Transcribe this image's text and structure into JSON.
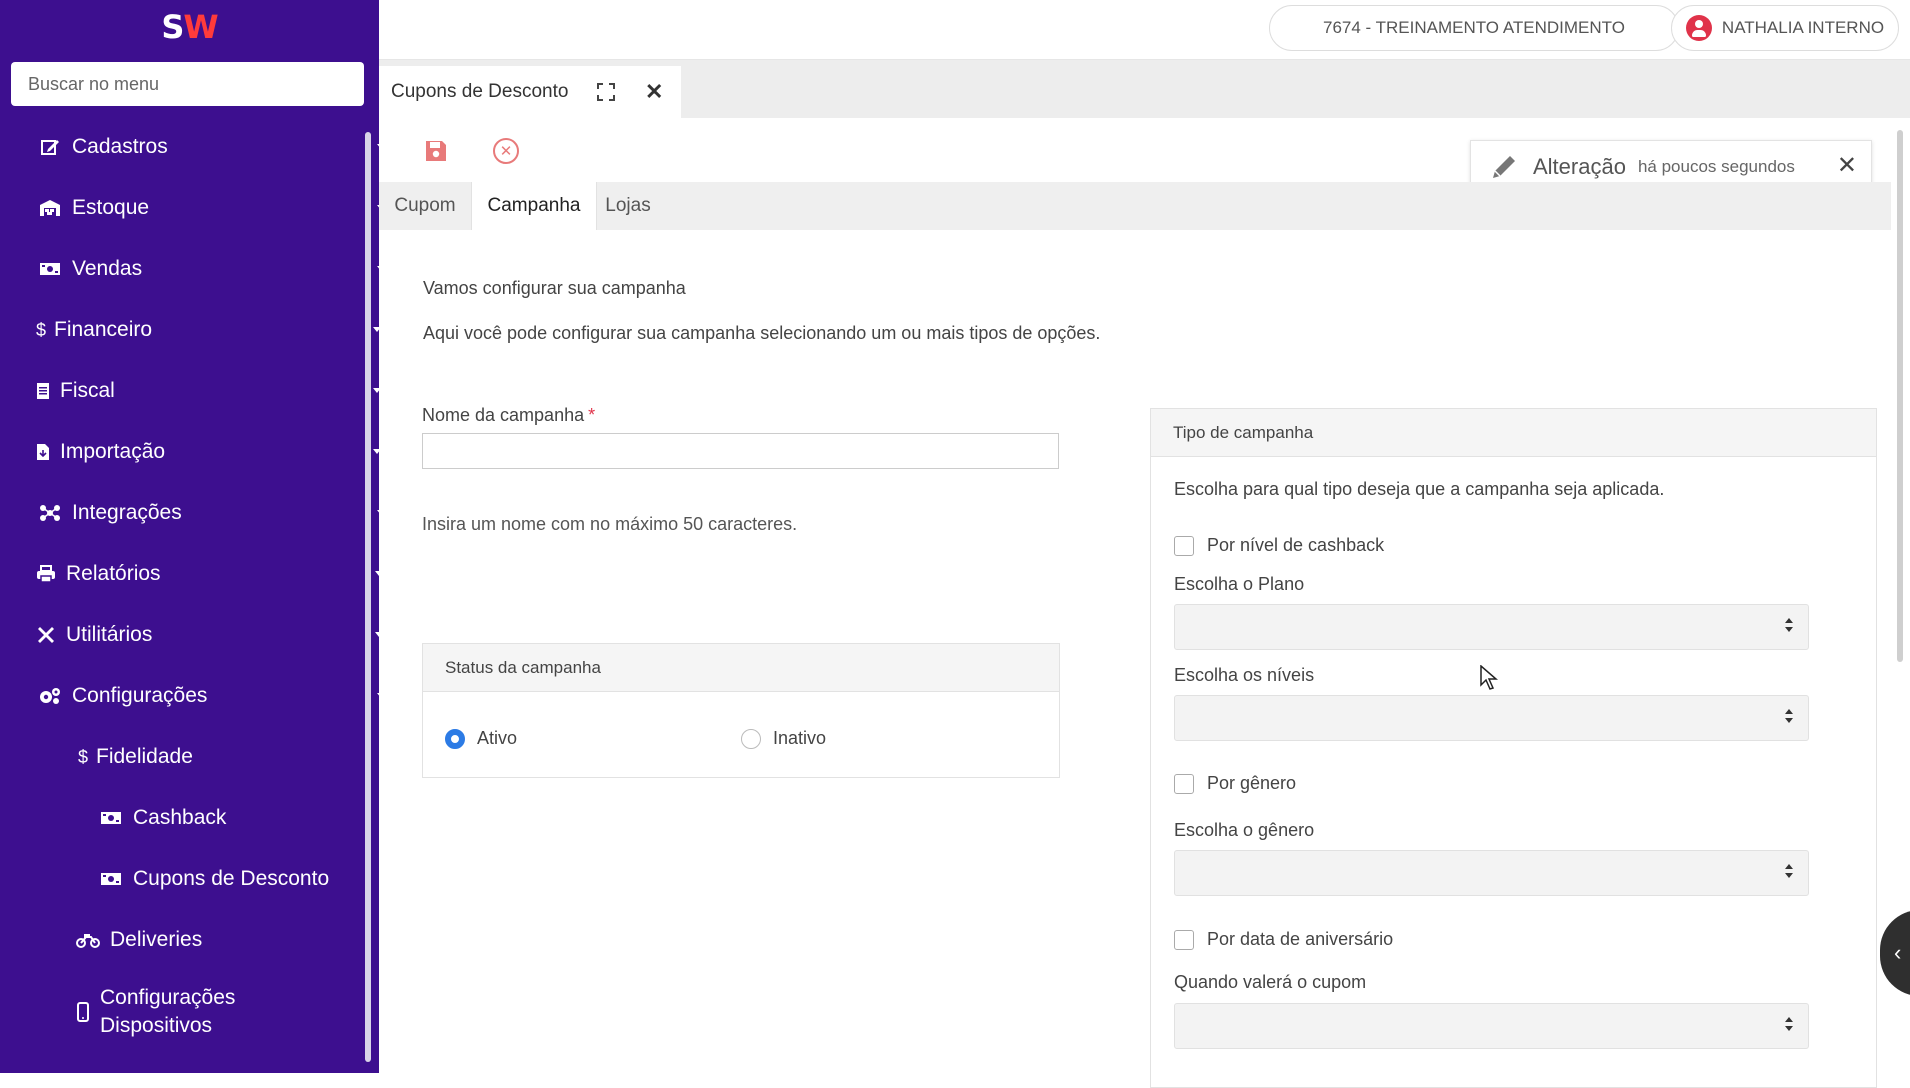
{
  "brand": {
    "logo_s": "S",
    "logo_w": "W"
  },
  "sidebar": {
    "search_placeholder": "Buscar no menu",
    "items": [
      {
        "label": "Cadastros",
        "icon": "edit-icon"
      },
      {
        "label": "Estoque",
        "icon": "warehouse-icon"
      },
      {
        "label": "Vendas",
        "icon": "cash-icon"
      },
      {
        "label": "Financeiro",
        "icon": "dollar-icon"
      },
      {
        "label": "Fiscal",
        "icon": "document-icon"
      },
      {
        "label": "Importação",
        "icon": "file-import-icon"
      },
      {
        "label": "Integrações",
        "icon": "network-icon"
      },
      {
        "label": "Relatórios",
        "icon": "print-icon"
      },
      {
        "label": "Utilitários",
        "icon": "tools-icon"
      },
      {
        "label": "Configurações",
        "icon": "gears-icon"
      },
      {
        "label": "Fidelidade",
        "icon": "dollar-icon"
      },
      {
        "label": "Cashback",
        "icon": "cash-icon"
      },
      {
        "label": "Cupons de Desconto",
        "icon": "cash-icon"
      },
      {
        "label": "Deliveries",
        "icon": "motorcycle-icon"
      },
      {
        "label": "Configurações Dispositivos",
        "icon": "mobile-icon"
      }
    ]
  },
  "header": {
    "company": "7674 - TREINAMENTO ATENDIMENTO",
    "user": "NATHALIA INTERNO"
  },
  "tab": {
    "title": "Cupons de Desconto"
  },
  "toast": {
    "title": "Alteração",
    "time": "há poucos segundos"
  },
  "subtabs": [
    "Cupom",
    "Campanha",
    "Lojas"
  ],
  "form": {
    "intro_title": "Vamos configurar sua campanha",
    "intro_text": "Aqui você pode configurar sua campanha selecionando um ou mais tipos de opções.",
    "name_label": "Nome da campanha",
    "required_mark": "*",
    "name_value": "",
    "name_help": "Insira um nome com no máximo 50 caracteres.",
    "status": {
      "title": "Status da campanha",
      "options": [
        "Ativo",
        "Inativo"
      ],
      "selected": "Ativo"
    },
    "type": {
      "title": "Tipo de campanha",
      "description": "Escolha para qual tipo deseja que a campanha seja aplicada.",
      "cashback_check": "Por nível de cashback",
      "plan_label": "Escolha o Plano",
      "levels_label": "Escolha os níveis",
      "gender_check": "Por gênero",
      "gender_label": "Escolha o gênero",
      "birthday_check": "Por data de aniversário",
      "when_label": "Quando valerá o cupom"
    }
  },
  "colors": {
    "sidebar_bg": "#3d0f8f",
    "accent_red": "#e0334a",
    "radio_blue": "#2c7be5"
  }
}
